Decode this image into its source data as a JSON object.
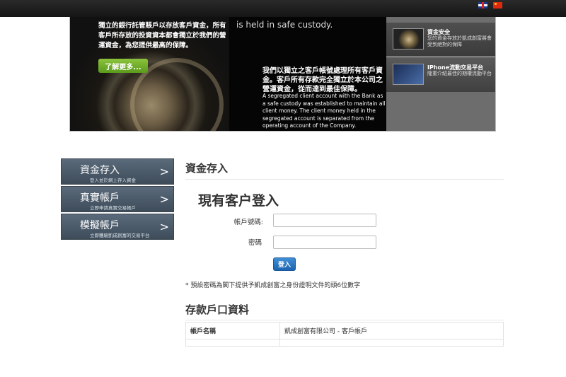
{
  "topbar": {
    "lang_en": "English",
    "lang_cn": "中文"
  },
  "banner": {
    "left_text": "獨立的銀行託管賬戶以存放客戶資金，所有客戶所存放的投資資本都會獨立於我們的營運資金，為您提供最高的保障。",
    "more_button": "了解更多...",
    "top_en": "is held in safe custody.",
    "zh_text": "我們以獨立之客戶帳號處理所有客戶資金。客戶所有存款完全獨立於本公司之營運資金，從而達到最佳保障。",
    "en_text": "A segregated client account with the Bank as a safe custody was established to maintain all client money. The client money held in the segregated account is separated from the operating account of the Company.",
    "side_items": [
      {
        "title": "資金安全",
        "desc": "您的資金存放於凱成創富將會受到絕對的保障"
      },
      {
        "title": "IPhone流動交易平台",
        "desc": "隆重介紹最佳的期權流動平台"
      }
    ]
  },
  "menu": {
    "items": [
      {
        "title": "資金存入",
        "sub": "登入並於網上存入資金"
      },
      {
        "title": "真實帳戶",
        "sub": "立即申請真實交易帳戶"
      },
      {
        "title": "模擬帳戶",
        "sub": "立即體驗凱成創富的交易平台"
      }
    ],
    "arrow": ">"
  },
  "main": {
    "section_title": "資金存入",
    "login_title": "現有客户登入",
    "account_label": "帳戶號碼:",
    "password_label": "密碼",
    "account_value": "",
    "password_value": "",
    "login_button": "登入",
    "note": "* 預設密碼為閣下提供予凱成創富之身份證明文件的頭6位數字",
    "deposit_title": "存款戶口資料",
    "table": [
      {
        "key": "帳戶名稱",
        "value": "凱成創富有限公司 - 客戶帳戶"
      }
    ]
  }
}
